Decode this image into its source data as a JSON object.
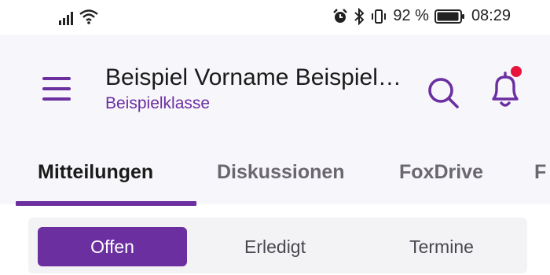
{
  "status_bar": {
    "battery_percent": "92 %",
    "time": "08:29"
  },
  "header": {
    "title": "Beispiel Vorname Beispiel…",
    "subtitle": "Beispielklasse"
  },
  "tabs": [
    {
      "label": "Mitteilungen",
      "active": true
    },
    {
      "label": "Diskussionen",
      "active": false
    },
    {
      "label": "FoxDrive",
      "active": false
    }
  ],
  "segments": [
    {
      "label": "Offen",
      "active": true
    },
    {
      "label": "Erledigt",
      "active": false
    },
    {
      "label": "Termine",
      "active": false
    }
  ],
  "colors": {
    "accent": "#6b2fa0",
    "notification_dot": "#e8143c",
    "header_background": "#f7f6fa"
  },
  "icons": {
    "menu": "hamburger-menu-icon",
    "search": "search-icon",
    "notifications": "bell-icon"
  }
}
